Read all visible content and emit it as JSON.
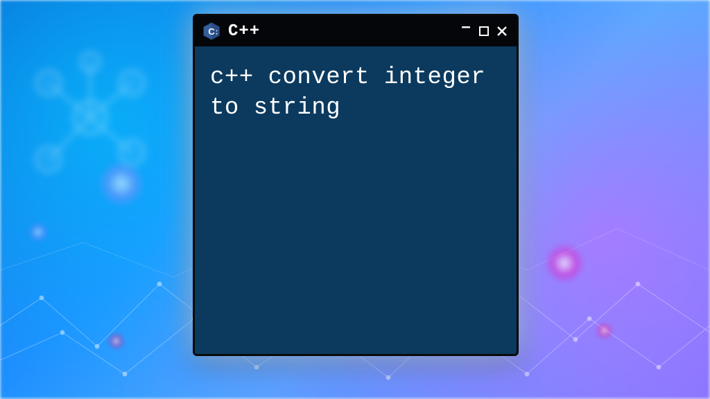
{
  "window": {
    "title": "C++",
    "content_text": "c++ convert integer to string"
  },
  "controls": {
    "minimize": "–",
    "maximize": "☐",
    "close": "✕"
  }
}
